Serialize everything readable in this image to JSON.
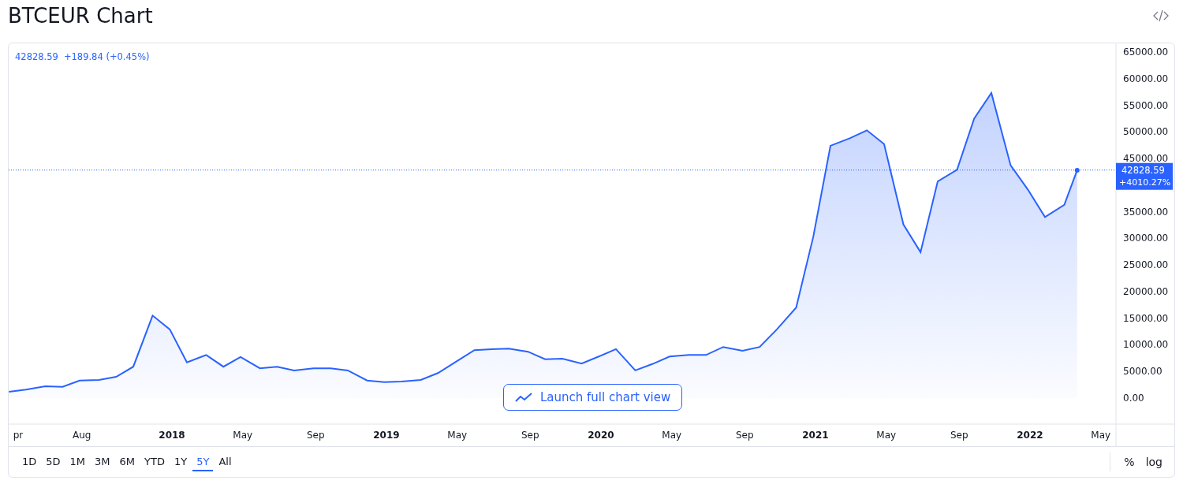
{
  "title": "BTCEUR Chart",
  "legend": {
    "price": "42828.59",
    "change": "+189.84 (+0.45%)"
  },
  "price_label": {
    "price": "42828.59",
    "change": "+4010.27%"
  },
  "launch_button": {
    "label": "Launch full chart view"
  },
  "chart_data": {
    "type": "area",
    "xlim": [
      2017.239,
      2022.673
    ],
    "ylim": [
      -9032,
      66629
    ],
    "ref_lines": [
      {
        "axis": "y",
        "value": 42828.59
      }
    ],
    "yticks": [
      {
        "value": 0,
        "label": "0.00"
      },
      {
        "value": 5000,
        "label": "5000.00"
      },
      {
        "value": 10000,
        "label": "10000.00"
      },
      {
        "value": 15000,
        "label": "15000.00"
      },
      {
        "value": 20000,
        "label": "20000.00"
      },
      {
        "value": 25000,
        "label": "25000.00"
      },
      {
        "value": 30000,
        "label": "30000.00"
      },
      {
        "value": 35000,
        "label": "35000.00"
      },
      {
        "value": 45000,
        "label": "45000.00"
      },
      {
        "value": 50000,
        "label": "50000.00"
      },
      {
        "value": 55000,
        "label": "55000.00"
      },
      {
        "value": 60000,
        "label": "60000.00"
      },
      {
        "value": 65000,
        "label": "65000.00"
      }
    ],
    "xticks": [
      {
        "value": 2017.25,
        "label": "pr"
      },
      {
        "value": 2017.58,
        "label": "Aug"
      },
      {
        "value": 2018,
        "label": "2018"
      },
      {
        "value": 2018.33,
        "label": "May"
      },
      {
        "value": 2018.67,
        "label": "Sep"
      },
      {
        "value": 2019,
        "label": "2019"
      },
      {
        "value": 2019.33,
        "label": "May"
      },
      {
        "value": 2019.67,
        "label": "Sep"
      },
      {
        "value": 2020,
        "label": "2020"
      },
      {
        "value": 2020.33,
        "label": "May"
      },
      {
        "value": 2020.67,
        "label": "Sep"
      },
      {
        "value": 2021,
        "label": "2021"
      },
      {
        "value": 2021.33,
        "label": "May"
      },
      {
        "value": 2021.67,
        "label": "Sep"
      },
      {
        "value": 2022,
        "label": "2022"
      },
      {
        "value": 2022.33,
        "label": "May"
      }
    ],
    "x": [
      2017.24,
      2017.32,
      2017.41,
      2017.49,
      2017.57,
      2017.66,
      2017.74,
      2017.82,
      2017.91,
      2017.99,
      2018.07,
      2018.16,
      2018.24,
      2018.32,
      2018.41,
      2018.49,
      2018.57,
      2018.66,
      2018.74,
      2018.82,
      2018.91,
      2018.99,
      2019.07,
      2019.16,
      2019.24,
      2019.32,
      2019.41,
      2019.49,
      2019.57,
      2019.66,
      2019.74,
      2019.82,
      2019.91,
      2019.99,
      2020.07,
      2020.16,
      2020.24,
      2020.32,
      2020.41,
      2020.49,
      2020.57,
      2020.66,
      2020.74,
      2020.82,
      2020.91,
      2020.99,
      2021.07,
      2021.16,
      2021.24,
      2021.32,
      2021.41,
      2021.49,
      2021.57,
      2021.66,
      2021.74,
      2021.82,
      2021.91,
      2021.99,
      2022.07,
      2022.16,
      2022.22
    ],
    "series": [
      {
        "color": "#2962ff",
        "values": [
          1200,
          1600,
          2200,
          2100,
          3300,
          3400,
          4000,
          5900,
          15500,
          12900,
          6700,
          8100,
          5900,
          7700,
          5600,
          5900,
          5200,
          5600,
          5600,
          5200,
          3300,
          3000,
          3100,
          3400,
          4700,
          6700,
          9000,
          9200,
          9300,
          8700,
          7300,
          7400,
          6500,
          7800,
          9200,
          5200,
          6400,
          7800,
          8100,
          8100,
          9600,
          8900,
          9600,
          12900,
          17000,
          30300,
          47400,
          48800,
          50300,
          47700,
          32600,
          27400,
          40700,
          42900,
          52500,
          57300,
          43700,
          39200,
          34000,
          36300,
          42800
        ]
      }
    ]
  },
  "ranges": [
    {
      "label": "1D",
      "selected": false
    },
    {
      "label": "5D",
      "selected": false
    },
    {
      "label": "1M",
      "selected": false
    },
    {
      "label": "3M",
      "selected": false
    },
    {
      "label": "6M",
      "selected": false
    },
    {
      "label": "YTD",
      "selected": false
    },
    {
      "label": "1Y",
      "selected": false
    },
    {
      "label": "5Y",
      "selected": true
    },
    {
      "label": "All",
      "selected": false
    }
  ],
  "scale_buttons": [
    "%",
    "log"
  ]
}
